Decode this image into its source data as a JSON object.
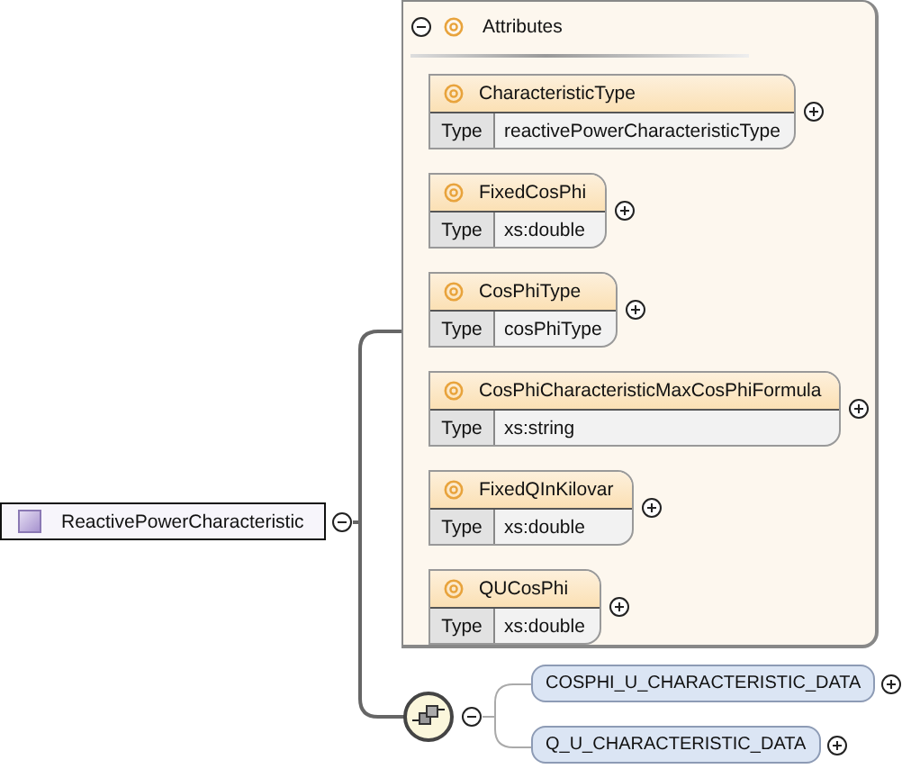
{
  "root": {
    "name": "ReactivePowerCharacteristic",
    "expanded": true
  },
  "attributes": {
    "title": "Attributes",
    "expanded": true,
    "items": [
      {
        "name": "CharacteristicType",
        "type_label": "Type",
        "type": "reactivePowerCharacteristicType",
        "expanded": false
      },
      {
        "name": "FixedCosPhi",
        "type_label": "Type",
        "type": "xs:double",
        "expanded": false
      },
      {
        "name": "CosPhiType",
        "type_label": "Type",
        "type": "cosPhiType",
        "expanded": false
      },
      {
        "name": "CosPhiCharacteristicMaxCosPhiFormula",
        "type_label": "Type",
        "type": "xs:string",
        "expanded": false
      },
      {
        "name": "FixedQInKilovar",
        "type_label": "Type",
        "type": "xs:double",
        "expanded": false
      },
      {
        "name": "QUCosPhi",
        "type_label": "Type",
        "type": "xs:double",
        "expanded": false
      }
    ]
  },
  "sequence": {
    "expanded": true,
    "elements": [
      {
        "name": "COSPHI_U_CHARACTERISTIC_DATA",
        "expanded": false
      },
      {
        "name": "Q_U_CHARACTERISTIC_DATA",
        "expanded": false
      }
    ]
  }
}
